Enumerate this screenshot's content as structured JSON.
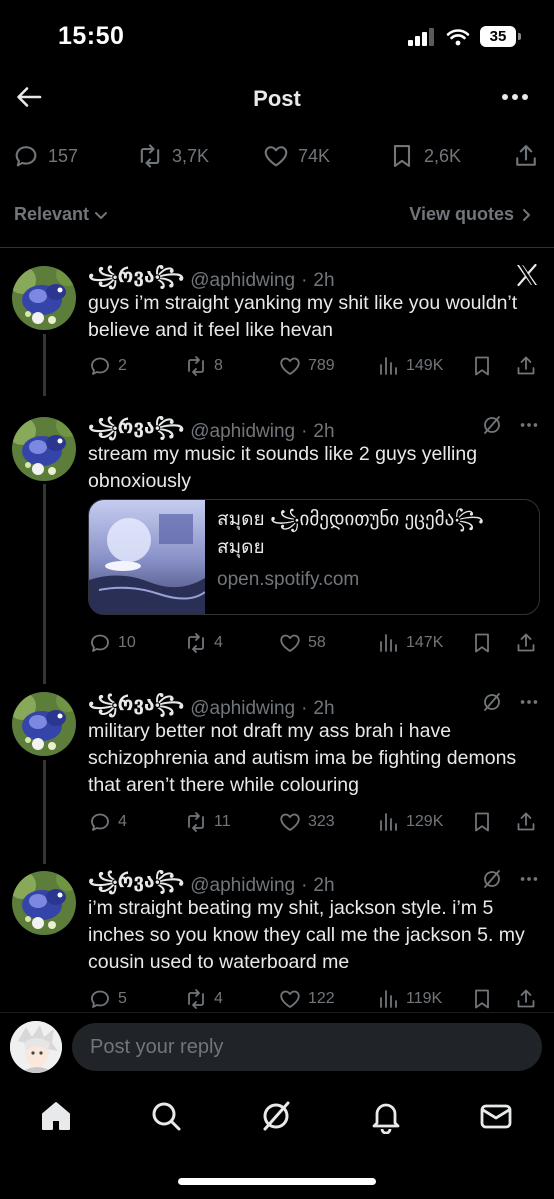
{
  "status_bar": {
    "time": "15:50",
    "battery": "35"
  },
  "header": {
    "title": "Post"
  },
  "metrics": {
    "replies": "157",
    "reposts": "3,7K",
    "likes": "74K",
    "bookmarks": "2,6K"
  },
  "filter": {
    "sort_label": "Relevant",
    "view_quotes_label": "View quotes"
  },
  "tweets": [
    {
      "name": "꧁რვა꧂",
      "handle": "@aphidwing",
      "dot": "·",
      "time": "2h",
      "text": "guys i’m straight yanking my shit like you wouldn’t believe and  it feel like hevan",
      "replies": "2",
      "reposts": "8",
      "likes": "789",
      "views": "149K"
    },
    {
      "name": "꧁რვა꧂",
      "handle": "@aphidwing",
      "dot": "·",
      "time": "2h",
      "text": "stream my music it sounds like 2 guys yelling obnoxiously",
      "card": {
        "line1": "สมุดย ꧁იმედითუნი ეცემა꧂",
        "line2": "สมุดย",
        "domain": "open.spotify.com"
      },
      "replies": "10",
      "reposts": "4",
      "likes": "58",
      "views": "147K"
    },
    {
      "name": "꧁რვა꧂",
      "handle": "@aphidwing",
      "dot": "·",
      "time": "2h",
      "text": "military better not draft my ass brah i have schizophrenia and autism ima be fighting demons that aren’t there while colouring",
      "replies": "4",
      "reposts": "11",
      "likes": "323",
      "views": "129K"
    },
    {
      "name": "꧁რვა꧂",
      "handle": "@aphidwing",
      "dot": "·",
      "time": "2h",
      "text": "i’m straight beating my shit, jackson style. i’m 5 inches so you know they call me the jackson 5. my cousin used to waterboard me",
      "replies": "5",
      "reposts": "4",
      "likes": "122",
      "views": "119K"
    }
  ],
  "reply": {
    "placeholder": "Post your reply"
  },
  "icons": {
    "back": "arrow-left-icon",
    "more": "more-horizontal-icon",
    "reply": "speech-bubble-icon",
    "repost": "repost-icon",
    "like": "heart-icon",
    "bookmark": "bookmark-icon",
    "share": "share-icon",
    "views": "bar-chart-icon",
    "grok": "grok-icon",
    "x_logo": "x-logo-icon",
    "home": "home-icon",
    "search": "search-icon",
    "notifications": "bell-icon",
    "messages": "mail-icon"
  },
  "colors": {
    "background": "#000000",
    "text": "#e7e9ea",
    "muted": "#71767b",
    "divider": "#2f3336",
    "input_bg": "#202327"
  }
}
